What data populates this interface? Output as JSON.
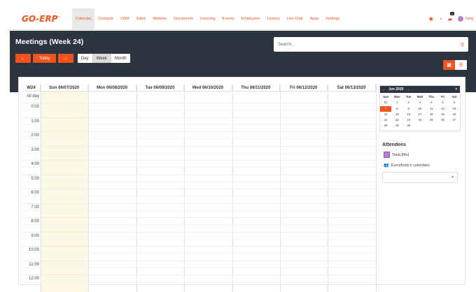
{
  "app": {
    "logo": "GO-ERP",
    "logo_mark": "™"
  },
  "nav": {
    "items": [
      "Calendar",
      "Contacts",
      "CRM",
      "Sales",
      "Website",
      "Documents",
      "Invoicing",
      "Events",
      "Employees",
      "Leaves",
      "Live Chat",
      "Apps",
      "Settings"
    ],
    "active": "Calendar",
    "notification_count": "1",
    "user_name": "Tariq"
  },
  "header": {
    "title": "Meetings (Week 24)",
    "prev_icon": "arrow-left",
    "today_label": "Today",
    "next_icon": "arrow-right",
    "scale": [
      "Day",
      "Week",
      "Month"
    ],
    "active_scale": "Week",
    "search_placeholder": "Search..."
  },
  "calendar": {
    "week_label": "W24",
    "columns": [
      "Sun 06/07/2020",
      "Mon 06/08/2020",
      "Tue 06/09/2020",
      "Wed 06/10/2020",
      "Thu 06/11/2020",
      "Fri 06/12/2020",
      "Sat 06/13/2020"
    ],
    "all_day": "All day",
    "hours": [
      "0:00",
      "1:00",
      "2:00",
      "3:00",
      "4:00",
      "5:00",
      "6:00",
      "7:00",
      "8:00",
      "9:00",
      "10:00",
      "11:00",
      "12:00"
    ]
  },
  "mini_calendar": {
    "month": "Jun 2020",
    "weekdays": [
      "Sun",
      "Mon",
      "Tue",
      "Wed",
      "Thu",
      "Fri",
      "Sat"
    ],
    "weeks": [
      [
        "31",
        "1",
        "2",
        "3",
        "4",
        "5",
        "6"
      ],
      [
        "7",
        "8",
        "9",
        "10",
        "11",
        "12",
        "13"
      ],
      [
        "14",
        "15",
        "16",
        "17",
        "18",
        "19",
        "20"
      ],
      [
        "21",
        "22",
        "23",
        "24",
        "25",
        "26",
        "27"
      ],
      [
        "28",
        "29",
        "30",
        "",
        "",
        "",
        ""
      ]
    ],
    "selected": "7"
  },
  "attendees": {
    "title": "Attendees",
    "me": "Tariq [Me]",
    "everybody": "Everybody's calendars"
  },
  "colors": {
    "accent": "#f0541e",
    "dark": "#2c3440",
    "today": "#fdf8e4"
  }
}
